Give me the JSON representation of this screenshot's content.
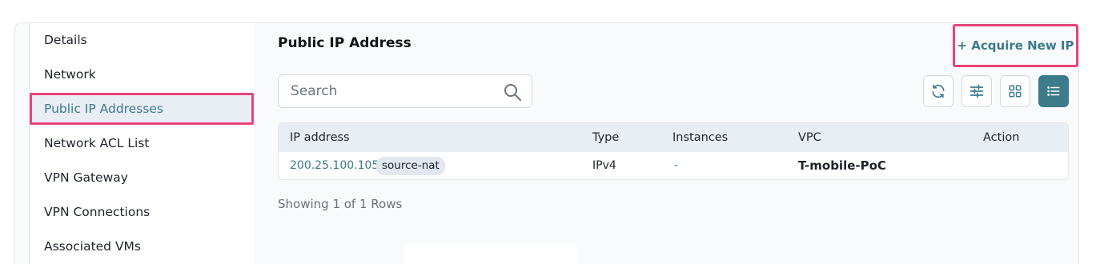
{
  "sidebar": {
    "items": [
      {
        "label": "Details"
      },
      {
        "label": "Network"
      },
      {
        "label": "Public IP Addresses",
        "active": true
      },
      {
        "label": "Network ACL List"
      },
      {
        "label": "VPN Gateway"
      },
      {
        "label": "VPN Connections"
      },
      {
        "label": "Associated VMs"
      }
    ]
  },
  "main": {
    "title": "Public IP Address",
    "acquire_label": "+ Acquire New IP",
    "search": {
      "placeholder": "Search",
      "value": ""
    },
    "toolbar": {
      "icons": [
        "refresh-icon",
        "filter-sliders-icon",
        "grid-view-icon",
        "list-view-icon"
      ],
      "active": "list-view-icon"
    },
    "table": {
      "columns": [
        "IP address",
        "Type",
        "Instances",
        "VPC",
        "Action"
      ],
      "rows": [
        {
          "ip": "200.25.100.105",
          "tag": "source-nat",
          "type": "IPv4",
          "instances": "-",
          "vpc": "T-mobile-PoC",
          "action": ""
        }
      ]
    },
    "footer": "Showing 1 of 1 Rows"
  },
  "colors": {
    "accent": "#3d7a8a",
    "highlight": "#e8447a",
    "header_bg": "#e9eef5",
    "panel_bg": "#f9fafb"
  }
}
